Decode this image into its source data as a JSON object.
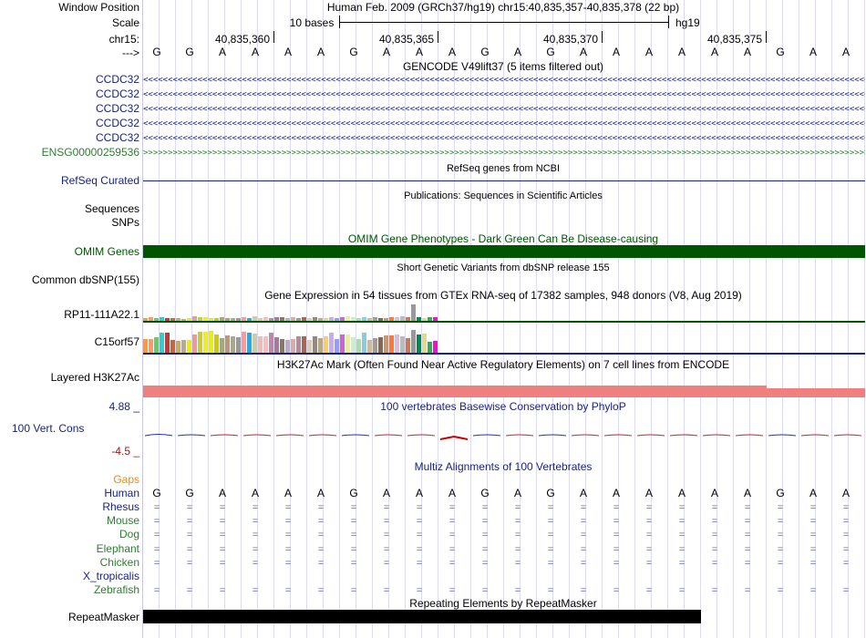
{
  "header": {
    "window_position_label": "Window Position",
    "scale_label": "Scale",
    "chrom_label": "chr15:",
    "arrow_label": "--->",
    "assembly_position": "Human Feb. 2009 (GRCh37/hg19)   chr15:40,835,357-40,835,378 (22 bp)",
    "scale_text": "10 bases",
    "scale_db": "hg19",
    "coords": [
      "40,835,360",
      "40,835,365",
      "40,835,370",
      "40,835,375"
    ]
  },
  "sequence": [
    "G",
    "G",
    "A",
    "A",
    "A",
    "A",
    "G",
    "A",
    "A",
    "A",
    "G",
    "A",
    "G",
    "A",
    "A",
    "A",
    "A",
    "A",
    "A",
    "G",
    "A",
    "A"
  ],
  "gencode": {
    "title": "GENCODE V49lift37 (5 items filtered out)",
    "tracks": [
      {
        "name": "CCDC32",
        "strand": "minus",
        "color": "#1a237e"
      },
      {
        "name": "CCDC32",
        "strand": "minus",
        "color": "#1a237e"
      },
      {
        "name": "CCDC32",
        "strand": "minus",
        "color": "#1a237e"
      },
      {
        "name": "CCDC32",
        "strand": "minus",
        "color": "#1a237e"
      },
      {
        "name": "CCDC32",
        "strand": "minus",
        "color": "#1a237e"
      },
      {
        "name": "ENSG00000259536",
        "strand": "plus",
        "color": "#2e7d32"
      }
    ]
  },
  "refseq": {
    "title": "RefSeq genes from NCBI",
    "label": "RefSeq Curated"
  },
  "publications": {
    "title": "Publications: Sequences in Scientific Articles",
    "label1": "Sequences",
    "label2": "SNPs"
  },
  "omim": {
    "title": "OMIM Gene Phenotypes - Dark Green Can Be Disease-causing",
    "label": "OMIM Genes",
    "bar_color": "#005500"
  },
  "dbsnp": {
    "title": "Short Genetic Variants from dbSNP release 155",
    "label": "Common dbSNP(155)"
  },
  "gtex": {
    "title": "Gene Expression in 54 tissues from GTEx RNA-seq of 17382 samples, 948 donors (V8, Aug 2019)",
    "gene1": "RP11-111A22.1",
    "gene2": "C15orf57",
    "gene1_values": [
      3,
      4,
      3,
      4,
      3,
      3,
      3,
      2,
      3,
      5,
      4,
      4,
      3,
      3,
      4,
      3,
      3,
      3,
      4,
      3,
      5,
      3,
      4,
      3,
      4,
      4,
      3,
      4,
      3,
      4,
      3,
      4,
      3,
      3,
      4,
      3,
      4,
      5,
      4,
      3,
      4,
      3,
      4,
      3,
      3,
      4,
      4,
      5,
      4,
      18,
      4,
      3,
      4,
      4
    ],
    "gene2_values": [
      15,
      15,
      17,
      22,
      22,
      14,
      13,
      14,
      14,
      20,
      23,
      23,
      24,
      20,
      16,
      19,
      18,
      17,
      23,
      22,
      21,
      18,
      18,
      22,
      17,
      15,
      14,
      15,
      18,
      18,
      14,
      18,
      16,
      18,
      22,
      15,
      20,
      20,
      17,
      15,
      22,
      14,
      16,
      17,
      19,
      19,
      20,
      18,
      16,
      25,
      20,
      21,
      12,
      13
    ],
    "colors": [
      "#ff9933",
      "#ff9966",
      "#66cc66",
      "#33cccc",
      "#cc3333",
      "#cc6633",
      "#ccaa66",
      "#bbaa88",
      "#eeee00",
      "#ee9999",
      "#cccc33",
      "#eeee22",
      "#eeee00",
      "#cccc00",
      "#aaaa66",
      "#bb9977",
      "#aaaa88",
      "#999999",
      "#ff9999",
      "#22aaee",
      "#ccccaa",
      "#eebbbb",
      "#ffbbbb",
      "#bb88aa",
      "#aa7799",
      "#887766",
      "#bbaacc",
      "#ddaaaa",
      "#bb8899",
      "#aa6655",
      "#ddccbb",
      "#998877",
      "#bbaa77",
      "#ffcc66",
      "#ccaaee",
      "#9999ff",
      "#cc66cc",
      "#eeee99",
      "#cceecc",
      "#aaddaa",
      "#88ccdd",
      "#ccbb99",
      "#aa9988",
      "#886655",
      "#cc9966",
      "#ff7733",
      "#ddbbdd",
      "#bbbbbb",
      "#cc7755",
      "#999999",
      "#008855",
      "#dddd88",
      "#33aa55",
      "#ee11cc"
    ]
  },
  "h3k27ac": {
    "title": "H3K27Ac Mark (Often Found Near Active Regulatory Elements) on 7 cell lines from ENCODE",
    "label": "Layered H3K27Ac",
    "color": "#f08080"
  },
  "phylop": {
    "title": "100 vertebrates Basewise Conservation by PhyloP",
    "label": "100 Vert. Cons",
    "max": "4.88 _",
    "min": "-4.5 _"
  },
  "multiz": {
    "title": "Multiz Alignments of 100 Vertebrates",
    "gaps_label": "Gaps",
    "human_label": "Human",
    "species": [
      "Rhesus",
      "Mouse",
      "Dog",
      "Elephant",
      "Chicken",
      "X_tropicalis",
      "Zebrafish"
    ],
    "species_colors": [
      "#1a237e",
      "#2e7d32",
      "#2e7d32",
      "#2e7d32",
      "#2e7d32",
      "#1a237e",
      "#2e7d32"
    ]
  },
  "repeatmasker": {
    "title": "Repeating Elements by RepeatMasker",
    "label": "RepeatMasker"
  }
}
